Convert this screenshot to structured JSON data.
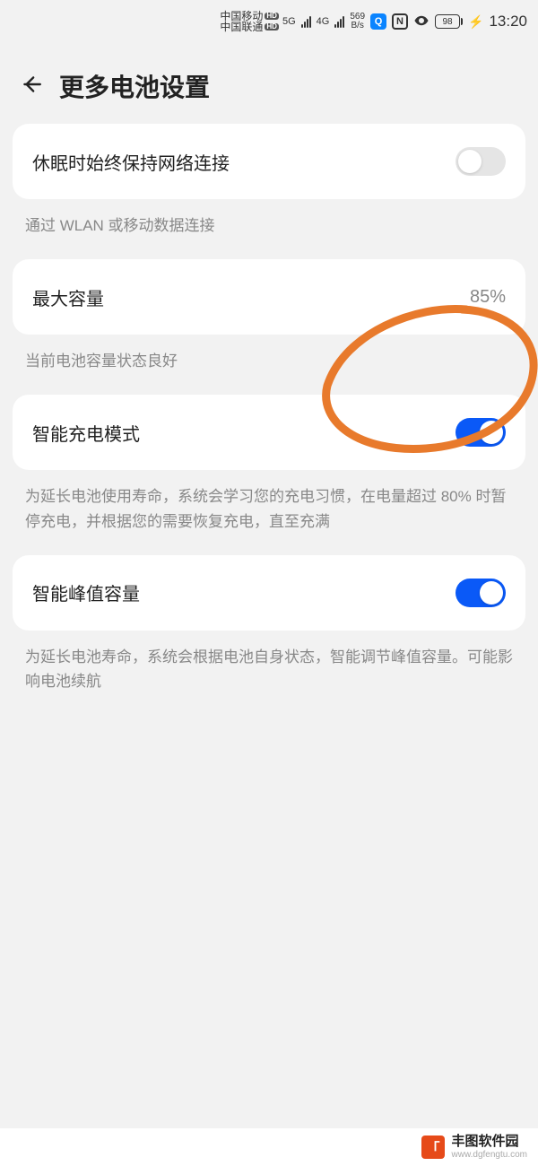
{
  "status_bar": {
    "carrier1": "中国移动",
    "carrier2": "中国联通",
    "hd_badge": "HD",
    "net1": "5G",
    "net2": "4G",
    "data_rate_top": "569",
    "data_rate_bottom": "B/s",
    "search_icon_letter": "Q",
    "nfc_letter": "N",
    "battery_level": "98",
    "time": "13:20"
  },
  "header": {
    "title": "更多电池设置"
  },
  "settings": {
    "network_sleep": {
      "label": "休眠时始终保持网络连接",
      "subtext": "通过 WLAN 或移动数据连接",
      "enabled": false
    },
    "max_capacity": {
      "label": "最大容量",
      "value": "85%",
      "subtext": "当前电池容量状态良好"
    },
    "smart_charging": {
      "label": "智能充电模式",
      "subtext": "为延长电池使用寿命，系统会学习您的充电习惯，在电量超过 80% 时暂停充电，并根据您的需要恢复充电，直至充满",
      "enabled": true
    },
    "smart_peak": {
      "label": "智能峰值容量",
      "subtext": "为延长电池寿命，系统会根据电池自身状态，智能调节峰值容量。可能影响电池续航",
      "enabled": true
    }
  },
  "footer": {
    "name": "丰图软件园",
    "url": "www.dgfengtu.com"
  }
}
